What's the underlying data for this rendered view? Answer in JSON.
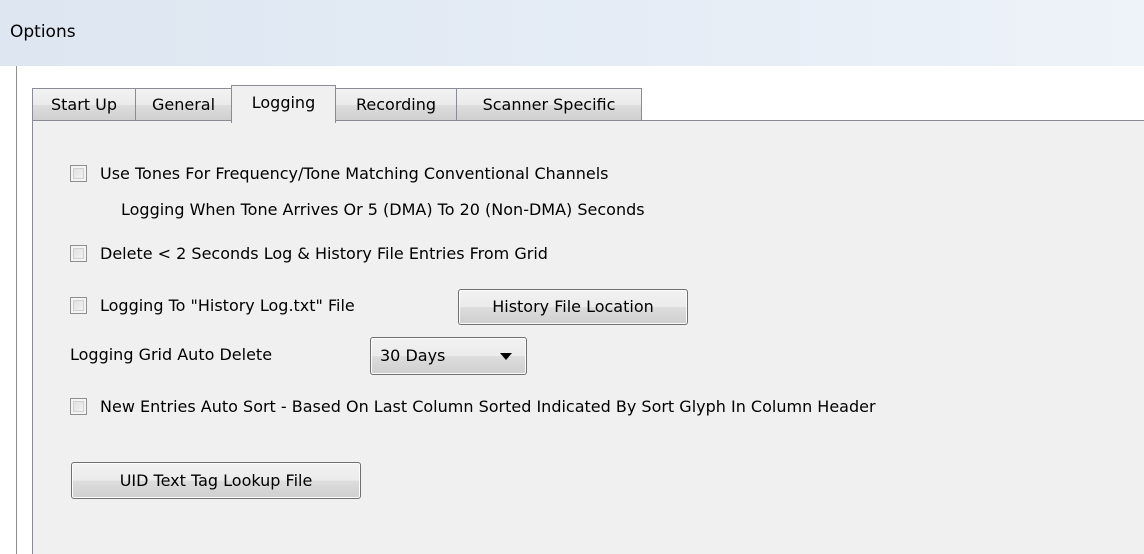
{
  "window": {
    "title": "Options"
  },
  "tabs": [
    {
      "label": "Start Up",
      "active": false
    },
    {
      "label": "General",
      "active": false
    },
    {
      "label": "Logging",
      "active": true
    },
    {
      "label": "Recording",
      "active": false
    },
    {
      "label": "Scanner Specific",
      "active": false
    }
  ],
  "logging": {
    "use_tones": {
      "checked": false,
      "label": "Use Tones For Frequency/Tone Matching Conventional Channels",
      "sublabel": "Logging When Tone Arrives Or 5 (DMA) To 20 (Non-DMA) Seconds"
    },
    "delete_short": {
      "checked": false,
      "label": "Delete < 2 Seconds Log & History File Entries From Grid"
    },
    "history_log": {
      "checked": false,
      "label": "Logging To \"History Log.txt\" File",
      "button_label": "History File Location"
    },
    "auto_delete": {
      "label": "Logging Grid Auto Delete",
      "selected": "30 Days"
    },
    "auto_sort": {
      "checked": false,
      "label": "New Entries Auto Sort - Based On Last Column Sorted Indicated By Sort Glyph In Column Header"
    },
    "uid_button_label": "UID Text Tag Lookup File"
  }
}
